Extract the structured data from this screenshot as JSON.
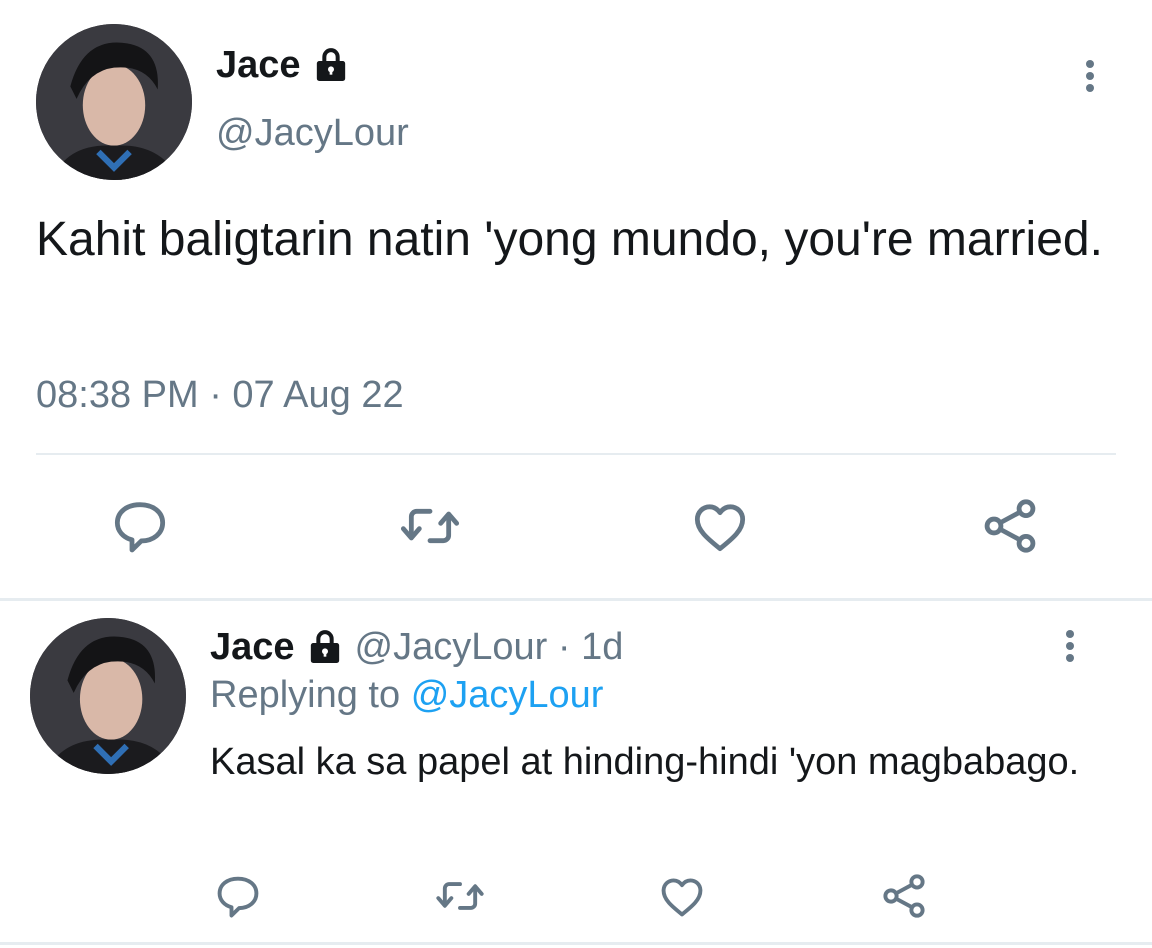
{
  "main_tweet": {
    "author_name": "Jace",
    "author_handle": "@JacyLour",
    "protected_icon": "lock-icon",
    "text": "Kahit baligtarin natin 'yong mundo, you're married.",
    "timestamp": "08:38 PM · 07 Aug 22",
    "actions": {
      "reply_icon": "reply-icon",
      "retweet_icon": "retweet-icon",
      "like_icon": "heart-icon",
      "share_icon": "share-icon"
    },
    "more_icon": "more-vertical-icon"
  },
  "reply_tweet": {
    "author_name": "Jace",
    "author_handle": "@JacyLour",
    "meta": "@JacyLour · 1d",
    "replying_prefix": "Replying to",
    "replying_handle": "@JacyLour",
    "text": "Kasal ka sa papel at hinding-hindi 'yon magbabago.",
    "actions": {
      "reply_icon": "reply-icon",
      "retweet_icon": "retweet-icon",
      "like_icon": "heart-icon",
      "share_icon": "share-icon"
    },
    "more_icon": "more-vertical-icon"
  },
  "colors": {
    "text_primary": "#14171a",
    "text_secondary": "#657786",
    "link": "#1da1f2",
    "divider": "#e6ecf0",
    "icon": "#657786"
  }
}
